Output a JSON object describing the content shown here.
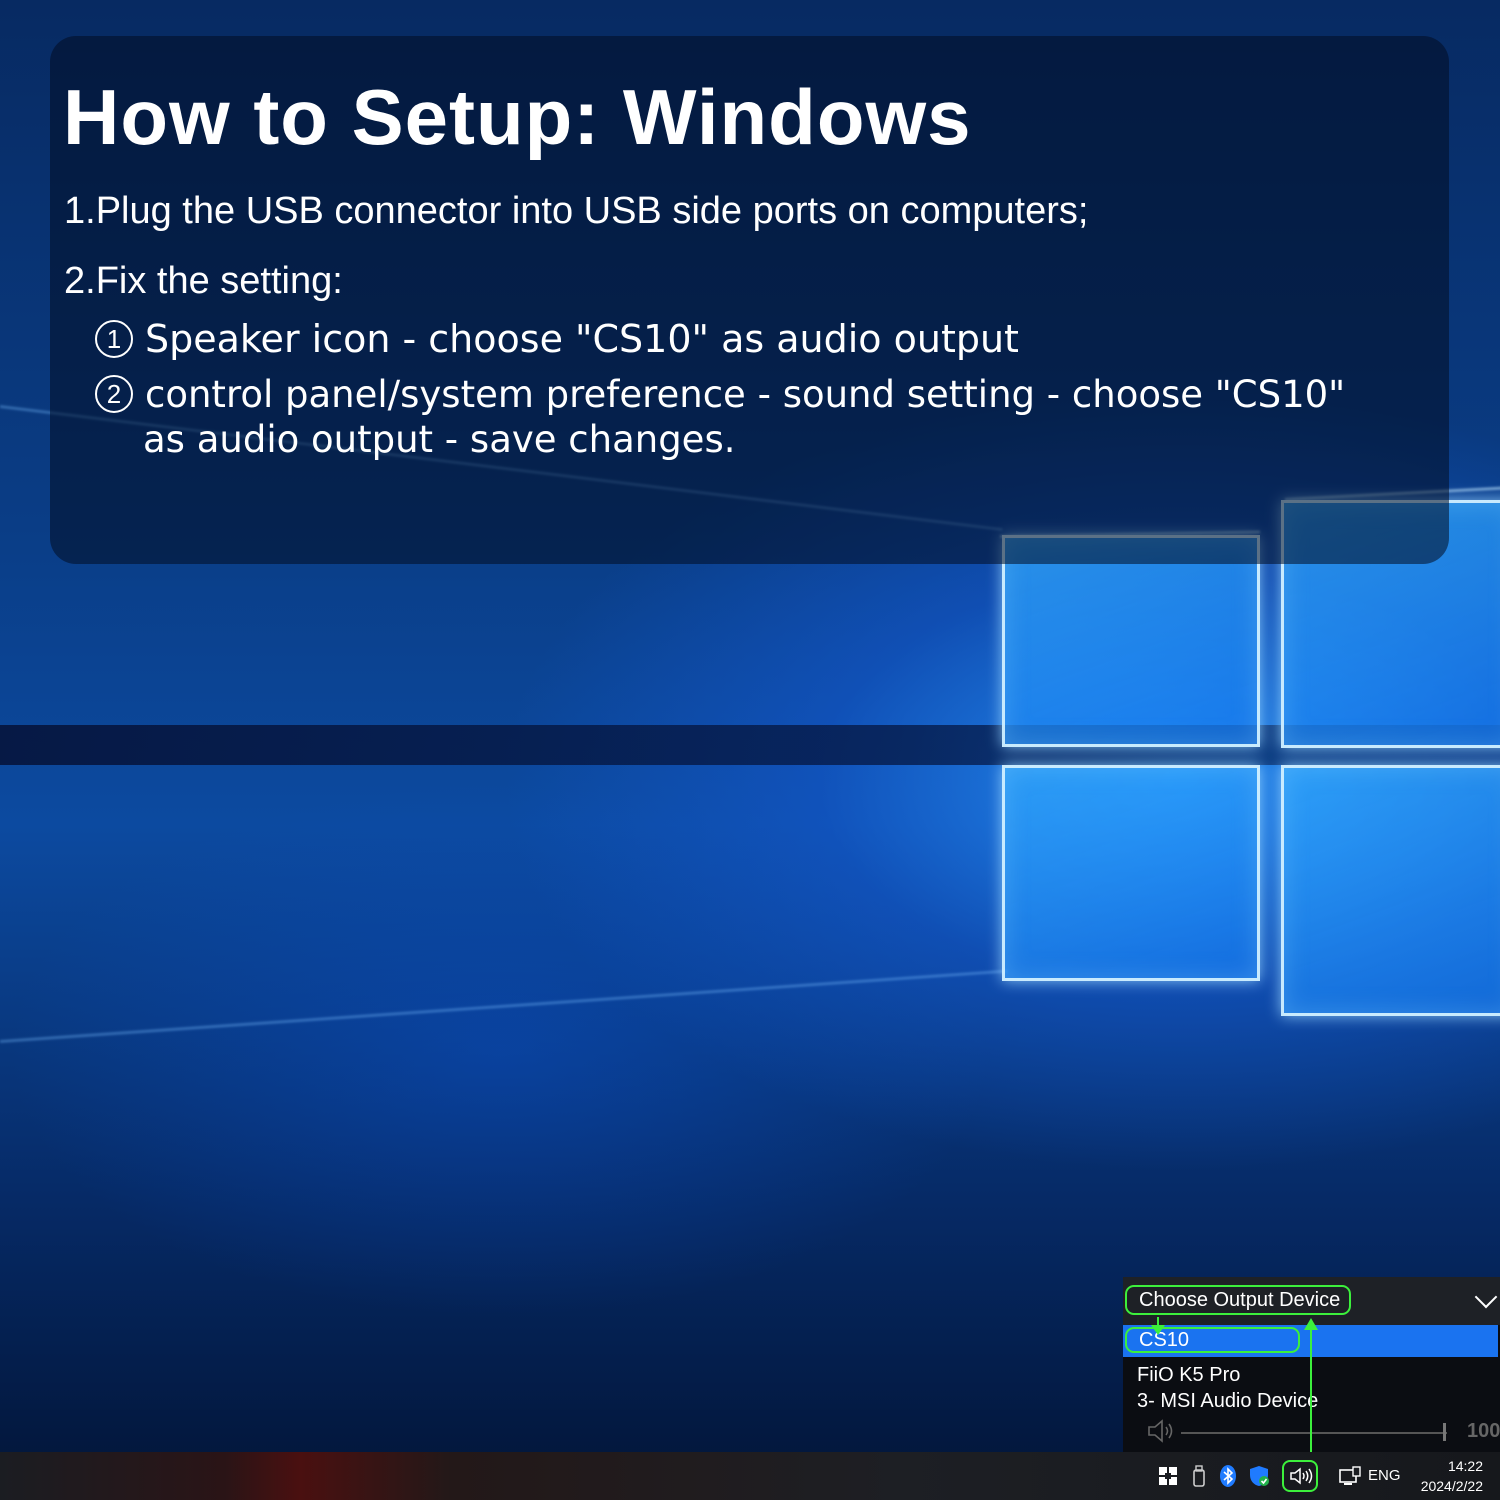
{
  "header": {
    "title": "How to Setup: Windows"
  },
  "instructions": {
    "step1": "1.Plug the USB connector into USB side ports on computers;",
    "step2": "2.Fix the setting:",
    "sub1": {
      "marker": "1",
      "text": "Speaker icon - choose \"CS10\" as audio output"
    },
    "sub2": {
      "marker": "2",
      "line1": "control panel/system preference - sound setting - choose \"CS10\"",
      "line2": "as audio output - save changes."
    }
  },
  "output_flyout": {
    "title": "Choose Output Device",
    "devices": [
      "CS10",
      "FiiO K5 Pro",
      "3- MSI Audio Device"
    ],
    "selected_device": "CS10",
    "volume": "100",
    "volume_fraction": 1.0
  },
  "taskbar": {
    "language": "ENG",
    "time": "14:22",
    "date": "2024/2/22",
    "icons": [
      "store-icon",
      "usb-drive-icon",
      "bluetooth-icon",
      "security-shield-icon",
      "speaker-icon",
      "network-icon"
    ]
  },
  "colors": {
    "highlight_green": "#3cf03c",
    "selection_blue": "#1a73f0"
  }
}
